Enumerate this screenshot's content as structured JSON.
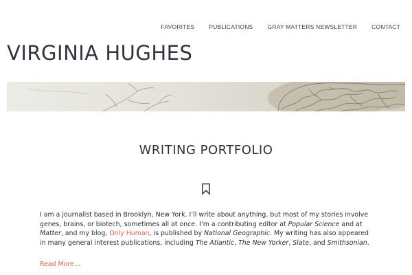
{
  "nav": {
    "items": [
      {
        "label": "FAVORITES"
      },
      {
        "label": "PUBLICATIONS"
      },
      {
        "label": "GRAY MATTERS NEWSLETTER"
      },
      {
        "label": "CONTACT"
      }
    ]
  },
  "site": {
    "title": "VIRGINIA HUGHES"
  },
  "banner": {
    "image": "anatomical-brain-illustration"
  },
  "portfolio": {
    "title": "WRITING PORTFOLIO",
    "icon": "bookmark-icon",
    "intro": {
      "t1": "I am a journalist based in Brooklyn, New York. I’ll write about anything, but most of my stories involve genes, brains, or biotech, sometimes all at once. I’m a contributing editor at ",
      "popsci": "Popular Science",
      "t2": " and at ",
      "matter": "Matter",
      "t3": ", and my blog, ",
      "blog_link": "Only Human",
      "t4": ", is published by ",
      "natgeo": "National Geographic",
      "t5": ". My writing has also appeared in many general interest publications, including ",
      "atlantic": "The Atlantic",
      "c1": ", ",
      "newyorker": "The New Yorker",
      "c2": ", ",
      "slate": "Slate",
      "t6": ", and ",
      "smithsonian": "Smithsonian",
      "t7": "."
    },
    "read_more": "Read More…"
  },
  "colors": {
    "accent": "#d45f4f",
    "text": "#2b2f36"
  }
}
